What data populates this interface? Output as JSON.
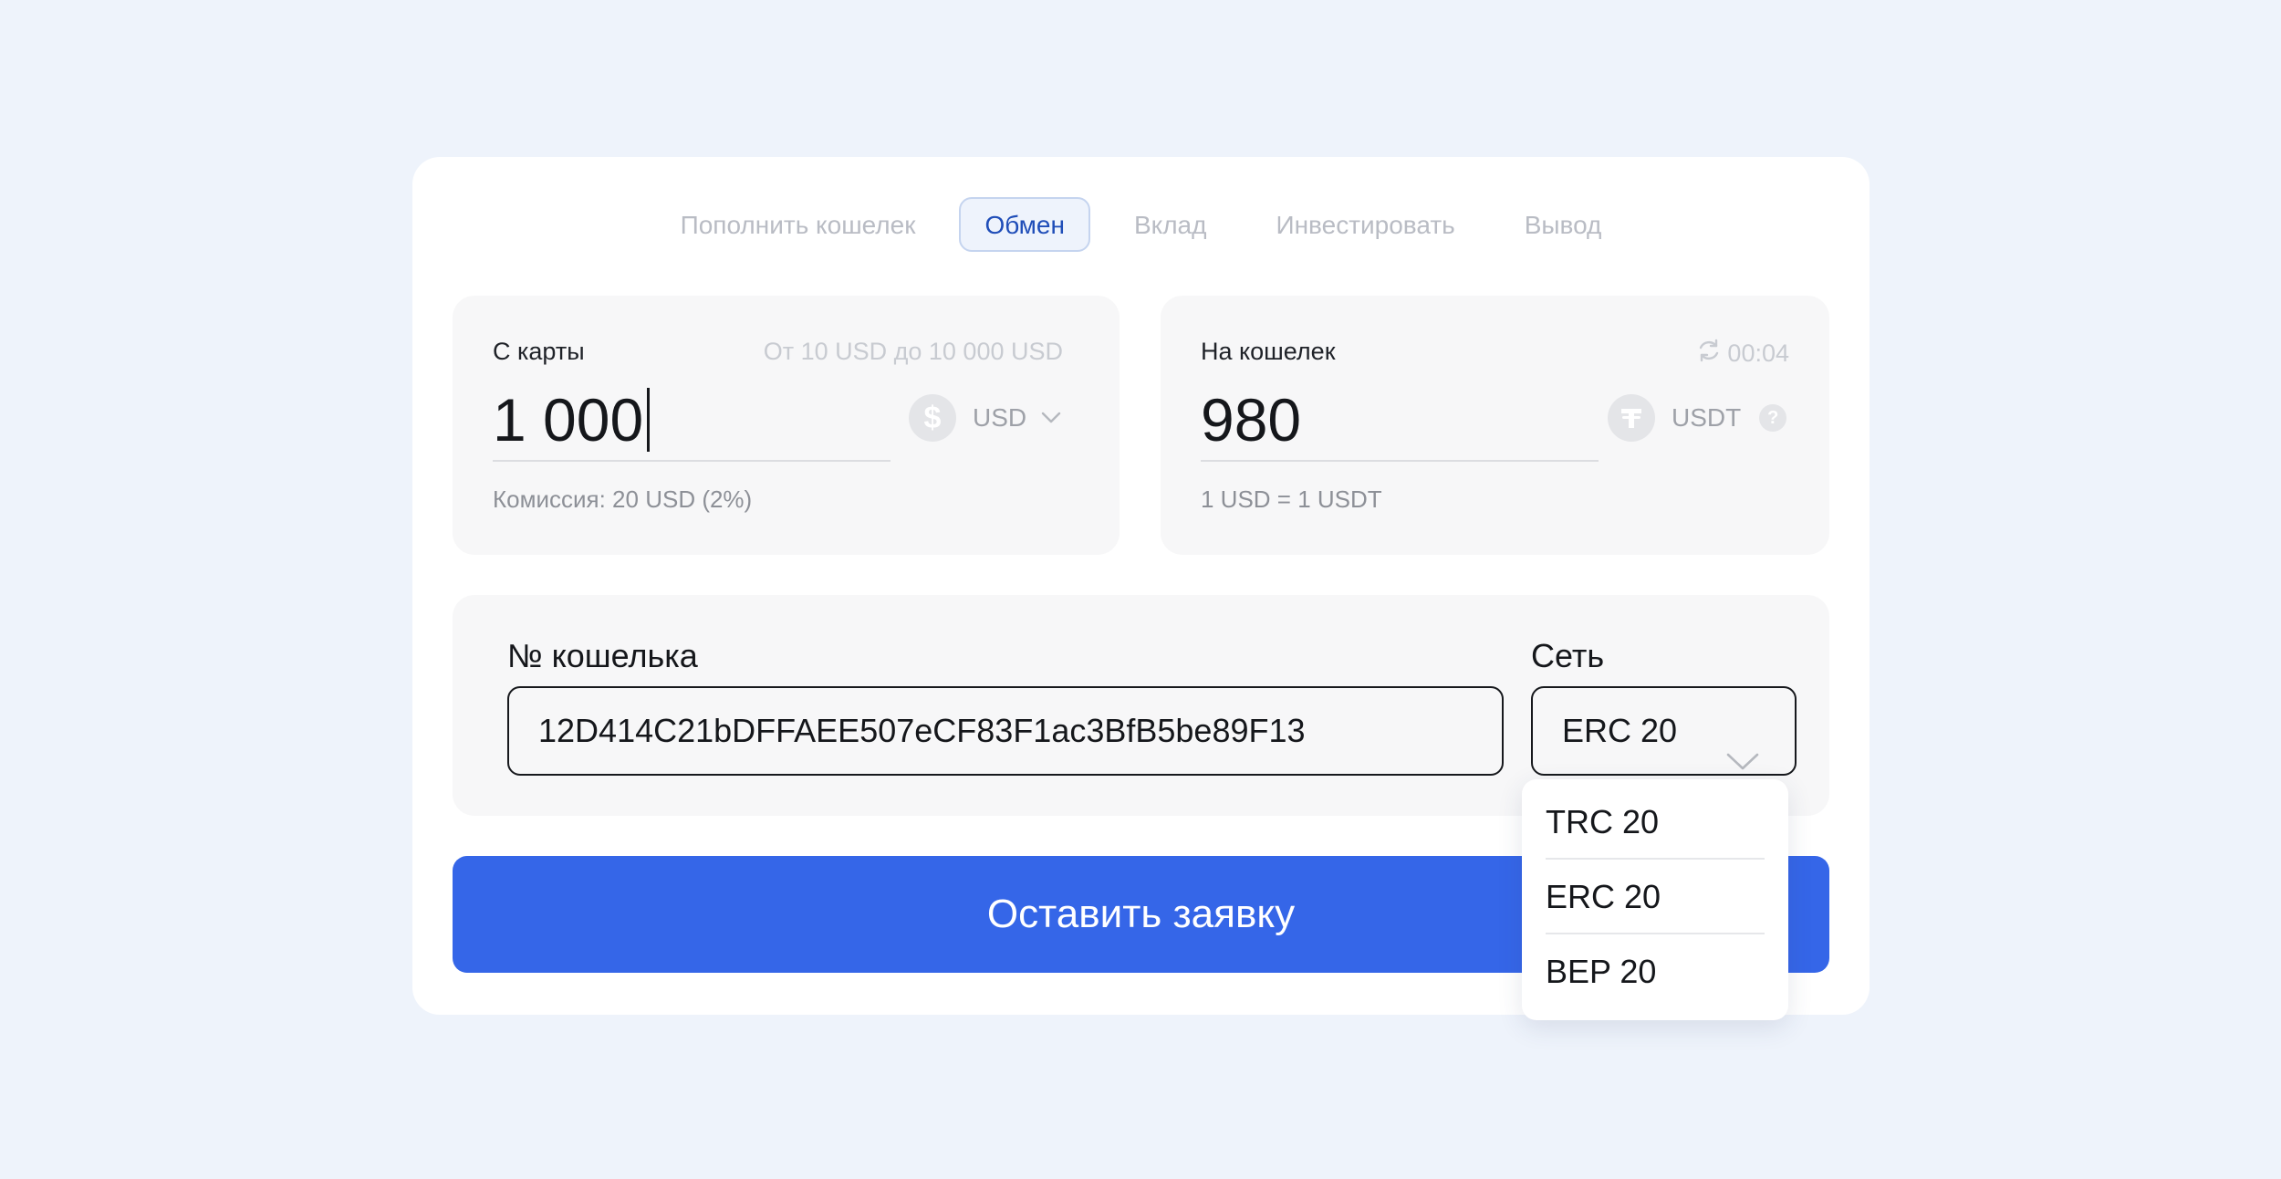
{
  "tabs": [
    {
      "label": "Пополнить кошелек",
      "active": false
    },
    {
      "label": "Обмен",
      "active": true
    },
    {
      "label": "Вклад",
      "active": false
    },
    {
      "label": "Инвестировать",
      "active": false
    },
    {
      "label": "Вывод",
      "active": false
    }
  ],
  "from": {
    "label": "С карты",
    "limit_hint": "От 10 USD до 10 000 USD",
    "amount": "1 000",
    "currency": "USD",
    "currency_icon": "dollar-icon",
    "commission": "Комиссия: 20 USD (2%)"
  },
  "to": {
    "label": "На кошелек",
    "timer": "00:04",
    "timer_icon": "refresh-icon",
    "amount": "980",
    "currency": "USDT",
    "currency_icon": "tether-icon",
    "help_glyph": "?",
    "rate": "1 USD = 1 USDT"
  },
  "wallet": {
    "label": "№ кошелька",
    "value": "12D414C21bDFFAEE507eCF83F1ac3BfB5be89F13"
  },
  "network": {
    "label": "Сеть",
    "selected": "ERC 20",
    "options": [
      "TRC 20",
      "ERC 20",
      "BEP 20"
    ]
  },
  "submit_label": "Оставить заявку",
  "colors": {
    "background": "#eef3fb",
    "accent": "#3566e8",
    "active_tab_text": "#1f4db8"
  }
}
